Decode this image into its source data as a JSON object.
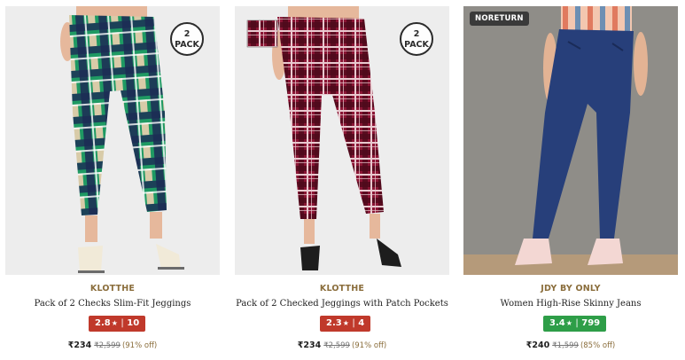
{
  "products": [
    {
      "brand": "KLOTTHE",
      "title": "Pack of 2 Checks Slim-Fit Jeggings",
      "rating": "2.8",
      "star": "★",
      "reviews": "10",
      "rating_color": "#c0392b",
      "badge_line1": "2",
      "badge_line2": "PACK",
      "price": "₹234",
      "mrp": "₹2,599",
      "discount": "(91% off)"
    },
    {
      "brand": "KLOTTHE",
      "title": "Pack of 2 Checked Jeggings with Patch Pockets",
      "rating": "2.3",
      "star": "★",
      "reviews": "4",
      "rating_color": "#c0392b",
      "badge_line1": "2",
      "badge_line2": "PACK",
      "price": "₹234",
      "mrp": "₹2,599",
      "discount": "(91% off)"
    },
    {
      "brand": "JDY BY ONLY",
      "title": "Women High-Rise Skinny Jeans",
      "rating": "3.4",
      "star": "★",
      "reviews": "799",
      "rating_color": "#2e9e48",
      "tag": "NORETURN",
      "price": "₹240",
      "mrp": "₹1,599",
      "discount": "(85% off)"
    }
  ]
}
